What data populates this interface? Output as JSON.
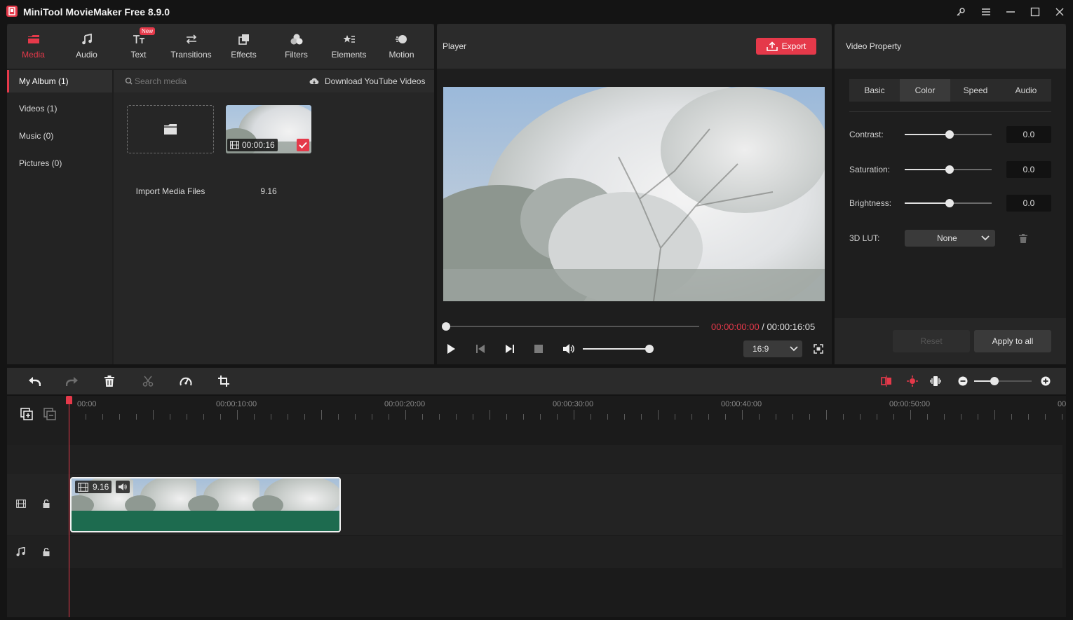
{
  "window": {
    "title": "MiniTool MovieMaker Free 8.9.0"
  },
  "toolbar_tabs": [
    {
      "label": "Media",
      "icon": "media-icon"
    },
    {
      "label": "Audio",
      "icon": "music-note-icon"
    },
    {
      "label": "Text",
      "icon": "text-icon"
    },
    {
      "label": "Transitions",
      "icon": "transitions-icon"
    },
    {
      "label": "Effects",
      "icon": "effects-icon"
    },
    {
      "label": "Filters",
      "icon": "filters-icon"
    },
    {
      "label": "Elements",
      "icon": "elements-icon"
    },
    {
      "label": "Motion",
      "icon": "motion-icon"
    }
  ],
  "text_badge": "New",
  "album": {
    "items": [
      "My Album (1)",
      "Videos (1)",
      "Music (0)",
      "Pictures (0)"
    ]
  },
  "media": {
    "search_placeholder": "Search media",
    "download_label": "Download YouTube Videos",
    "import_label": "Import Media Files",
    "clip_duration": "00:00:16",
    "clip_name": "9.16"
  },
  "player": {
    "title": "Player",
    "export_label": "Export",
    "current_time": "00:00:00:00",
    "time_separator": " / ",
    "total_time": "00:00:16:05",
    "aspect_ratio": "16:9",
    "progress_fraction": 0.0,
    "volume_fraction": 1.0
  },
  "property": {
    "title": "Video Property",
    "tabs": [
      "Basic",
      "Color",
      "Speed",
      "Audio"
    ],
    "active_tab": "Color",
    "contrast_label": "Contrast:",
    "contrast_value": "0.0",
    "saturation_label": "Saturation:",
    "saturation_value": "0.0",
    "brightness_label": "Brightness:",
    "brightness_value": "0.0",
    "lut_label": "3D LUT:",
    "lut_value": "None",
    "reset_label": "Reset",
    "apply_label": "Apply to all"
  },
  "timeline": {
    "ruler_labels": [
      "00:00",
      "00:00:10:00",
      "00:00:20:00",
      "00:00:30:00",
      "00:00:40:00",
      "00:00:50:00",
      "00"
    ],
    "clip_name": "9.16",
    "zoom_fraction": 0.35
  },
  "colors": {
    "accent": "#e5394a",
    "clip_green": "#1d6b4f"
  }
}
